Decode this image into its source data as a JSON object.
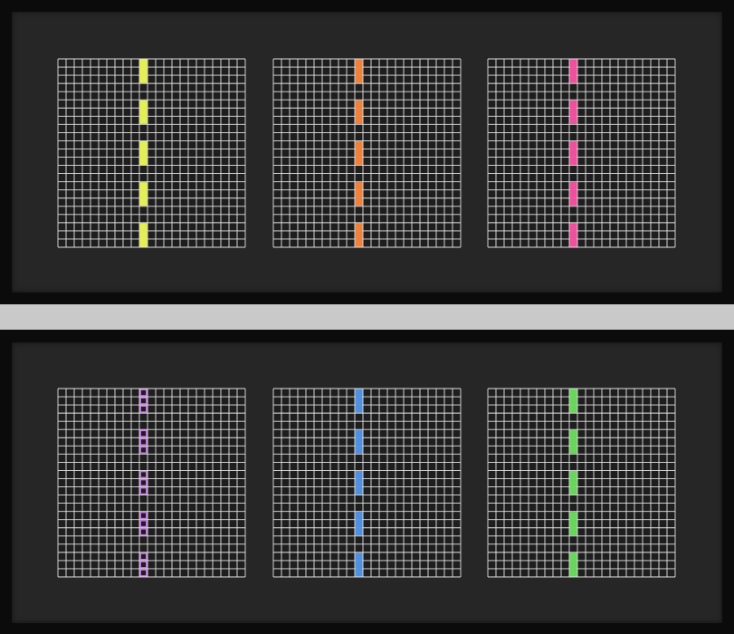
{
  "artwork": {
    "background_color": "#c9c9c9",
    "frame_color": "#0b0b0b",
    "mat_color": "#262626",
    "panel_color": "#1e1e1e",
    "grid_line_color": "#e6e6e6",
    "grid_cells": 23,
    "stripe_column_index": 10,
    "stripe_segments": [
      [
        0,
        3
      ],
      [
        5,
        8
      ],
      [
        10,
        13
      ],
      [
        15,
        18
      ],
      [
        20,
        23
      ]
    ],
    "frames": [
      {
        "name": "frame-top",
        "panels": [
          {
            "name": "panel-yellow",
            "stripe_color": "#e3f050",
            "stripe_style": "solid"
          },
          {
            "name": "panel-orange",
            "stripe_color": "#f0813c",
            "stripe_style": "solid"
          },
          {
            "name": "panel-pink",
            "stripe_color": "#ef4f9c",
            "stripe_style": "solid"
          }
        ]
      },
      {
        "name": "frame-bottom",
        "panels": [
          {
            "name": "panel-purple",
            "stripe_color": "#c877e6",
            "stripe_style": "outline"
          },
          {
            "name": "panel-blue",
            "stripe_color": "#4f90df",
            "stripe_style": "solid"
          },
          {
            "name": "panel-green",
            "stripe_color": "#68d65a",
            "stripe_style": "solid"
          }
        ]
      }
    ]
  }
}
